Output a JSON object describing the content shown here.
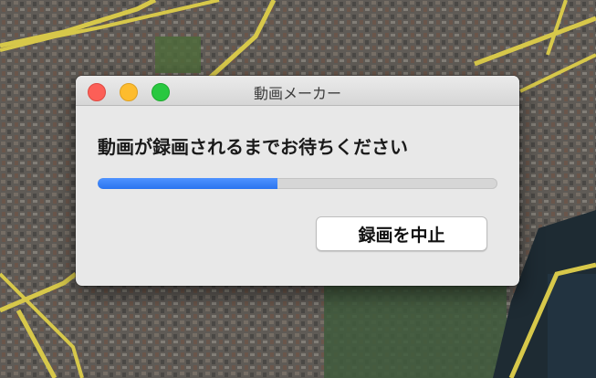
{
  "window": {
    "title": "動画メーカー"
  },
  "dialog": {
    "message": "動画が録画されるまでお待ちください",
    "progress": 0.45,
    "stop_label": "録画を中止"
  },
  "colors": {
    "progress_fill": "#2a74ef",
    "close": "#fc5f57",
    "minimize": "#fdbc2e",
    "zoom": "#29c840"
  }
}
